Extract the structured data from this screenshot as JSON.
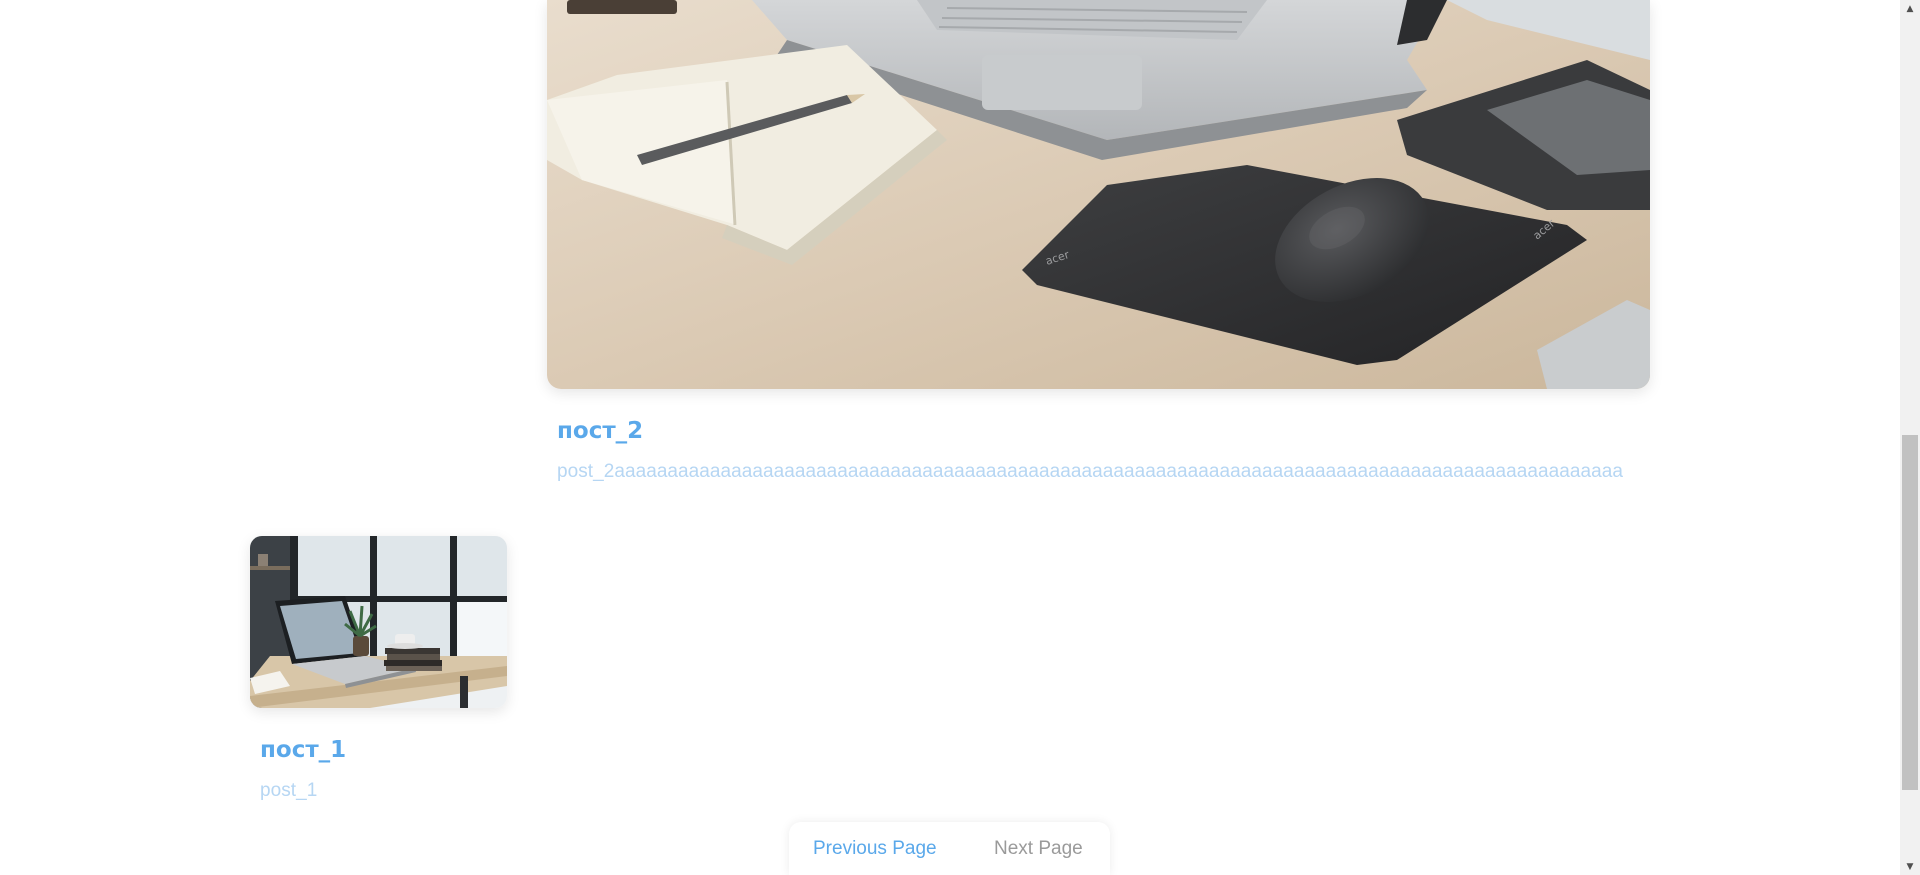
{
  "posts": [
    {
      "title": "пост_2",
      "excerpt": "post_2ааааааааааааааааааааааааааааааааааааааааааааааааааааааааааааааааааааааааааааааааааааааааааааааа",
      "image_alt": "Laptop, notebook and mouse on a desk"
    },
    {
      "title": "пост_1",
      "excerpt": "post_1",
      "image_alt": "Laptop on a desk near a window"
    }
  ],
  "pagination": {
    "previous_label": "Previous Page",
    "next_label": "Next Page"
  },
  "scrollbar": {
    "up_icon": "scroll-up-arrow-icon",
    "down_icon": "scroll-down-arrow-icon",
    "up_glyph": "▲",
    "down_glyph": "▼"
  },
  "colors": {
    "accent": "#5aa8ea",
    "excerpt": "#b6d6f3",
    "disabled": "#9a9a9a"
  }
}
